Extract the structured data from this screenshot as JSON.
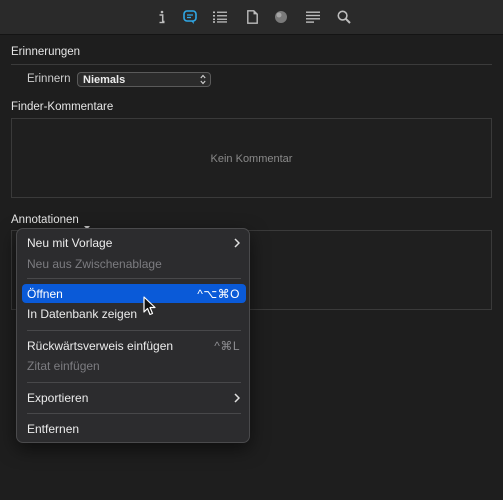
{
  "toolbar": {
    "icons": [
      "info-icon",
      "annotation-bubble-icon",
      "list-icon",
      "document-icon",
      "sphere-icon",
      "text-lines-icon",
      "search-icon"
    ],
    "active": "annotation-bubble-icon",
    "accent": "#2fa8e6"
  },
  "reminders": {
    "title": "Erinnerungen",
    "label": "Erinnern",
    "value": "Niemals"
  },
  "finder_comments": {
    "title": "Finder-Kommentare",
    "placeholder": "Kein Kommentar"
  },
  "annotations": {
    "title": "Annotationen"
  },
  "context_menu": {
    "highlight_color": "#0a5ad8",
    "items": [
      {
        "label": "Neu mit Vorlage",
        "submenu": true
      },
      {
        "label": "Neu aus Zwischenablage",
        "disabled": true
      },
      {
        "label": "Öffnen",
        "shortcut": "^⌥⌘O",
        "highlighted": true
      },
      {
        "label": "In Datenbank zeigen"
      },
      {
        "label": "Rückwärtsverweis einfügen",
        "shortcut": "^⌘L"
      },
      {
        "label": "Zitat einfügen",
        "disabled": true
      },
      {
        "label": "Exportieren",
        "submenu": true
      },
      {
        "label": "Entfernen"
      }
    ]
  }
}
